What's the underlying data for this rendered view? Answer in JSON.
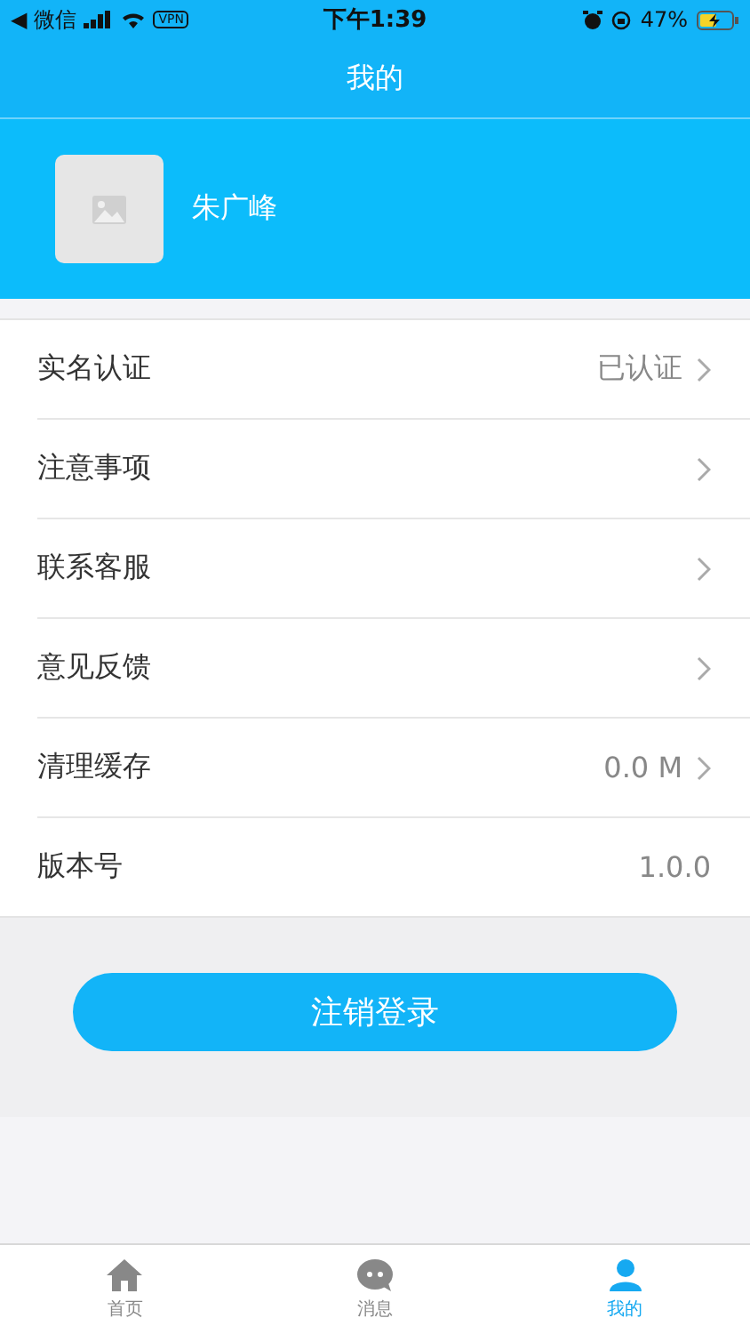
{
  "status_bar": {
    "back": "◀",
    "carrier": "微信",
    "vpn": "VPN",
    "time": "下午1:39",
    "battery": "47%"
  },
  "nav": {
    "title": "我的"
  },
  "profile": {
    "name": "朱广峰"
  },
  "menu": [
    {
      "label": "实名认证",
      "value": "已认证",
      "arrow": true
    },
    {
      "label": "注意事项",
      "arrow": true
    },
    {
      "label": "联系客服",
      "arrow": true
    },
    {
      "label": "意见反馈",
      "arrow": true
    },
    {
      "label": "清理缓存",
      "value": "0.0 M",
      "arrow": true
    },
    {
      "label": "版本号",
      "value": "1.0.0",
      "arrow": false
    }
  ],
  "logout_button": "注销登录",
  "tab_bar": [
    {
      "label": "首页",
      "kind": "home",
      "selected": false
    },
    {
      "label": "消息",
      "kind": "chat",
      "selected": false
    },
    {
      "label": "我的",
      "kind": "person",
      "selected": true
    }
  ]
}
